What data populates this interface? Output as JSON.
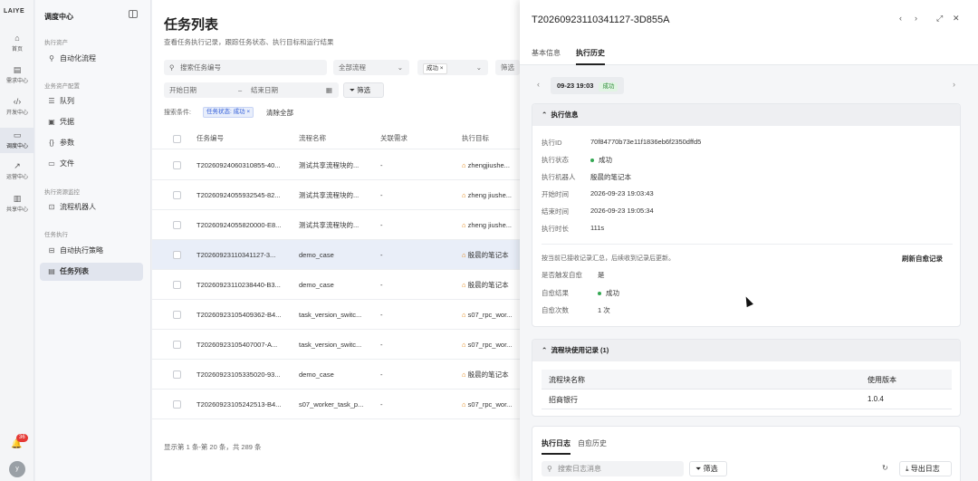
{
  "rail": {
    "logo": "LAIYE",
    "items": [
      {
        "label": "首页",
        "icon": "home-icon"
      },
      {
        "label": "需求中心",
        "icon": "document-icon"
      },
      {
        "label": "开发中心",
        "icon": "code-icon"
      },
      {
        "label": "调度中心",
        "icon": "monitor-icon"
      },
      {
        "label": "运营中心",
        "icon": "chart-icon"
      },
      {
        "label": "共享中心",
        "icon": "book-icon"
      }
    ],
    "notifications": "36",
    "avatar": "y"
  },
  "sidebar": {
    "title": "调度中心",
    "g1": "执行资产",
    "n1": "自动化流程",
    "g2": "业务资产配置",
    "n2": "队列",
    "n3": "凭据",
    "n4": "参数",
    "n5": "文件",
    "g3": "执行资源监控",
    "n6": "流程机器人",
    "g4": "任务执行",
    "n7": "自动执行策略",
    "n8": "任务列表"
  },
  "main": {
    "title": "任务列表",
    "subtitle": "查看任务执行记录，跟踪任务状态、执行目标和运行结果",
    "search_placeholder": "搜索任务编号",
    "flow_select": "全部流程",
    "status_tag": "成功",
    "filter_select": "筛选",
    "start_date": "开始日期",
    "date_sep": "–",
    "end_date": "结束日期",
    "filter_btn": "筛选",
    "cond_label": "搜索条件:",
    "cond_tag": "任务状态: 成功",
    "clear_all": "清除全部",
    "columns": [
      "任务编号",
      "流程名称",
      "关联需求",
      "执行目标"
    ],
    "rows": [
      [
        "T20260924060310855-40...",
        "测试共享流程块的...",
        "-",
        "zhengjiushe..."
      ],
      [
        "T20260924055932545-82...",
        "测试共享流程块的...",
        "-",
        "zheng jiushe..."
      ],
      [
        "T20260924055820000-E8...",
        "测试共享流程块的...",
        "-",
        "zheng jiushe..."
      ],
      [
        "T20260923110341127-3...",
        "demo_case",
        "-",
        "殷晨的笔记本"
      ],
      [
        "T20260923110238440-B3...",
        "demo_case",
        "-",
        "殷晨的笔记本"
      ],
      [
        "T20260923105409362-B4...",
        "task_version_switc...",
        "-",
        "s07_rpc_wor..."
      ],
      [
        "T20260923105407007-A...",
        "task_version_switc...",
        "-",
        "s07_rpc_wor..."
      ],
      [
        "T20260923105335020-93...",
        "demo_case",
        "-",
        "殷晨的笔记本"
      ],
      [
        "T20260923105242513-B4...",
        "s07_worker_task_p...",
        "-",
        "s07_rpc_wor..."
      ]
    ],
    "footer": "显示第 1 条-第 20 条，共 289 条"
  },
  "panel": {
    "title": "T20260923110341127-3D855A",
    "tab1": "基本信息",
    "tab2": "执行历史",
    "date_chip": "09-23 19:03",
    "date_status": "成功",
    "exec_title": "执行信息",
    "exec": [
      [
        "执行ID",
        "70f84770b73e11f1836eb6f2350dffd5"
      ],
      [
        "执行状态",
        "成功"
      ],
      [
        "执行机器人",
        "殷晨的笔记本"
      ],
      [
        "开始时间",
        "2026-09-23 19:03:43"
      ],
      [
        "结束时间",
        "2026-09-23 19:05:34"
      ],
      [
        "执行时长",
        "111s"
      ]
    ],
    "heal_note": "按当前已接收记录汇总，后续收到记录后更新。",
    "refresh": "刷新自愈记录",
    "heal": [
      [
        "是否触发自愈",
        "是"
      ],
      [
        "自愈结果",
        "成功"
      ],
      [
        "自愈次数",
        "1 次"
      ]
    ],
    "block_title": "流程块使用记录 (1)",
    "block_cols": [
      "流程块名称",
      "使用版本"
    ],
    "block_row": [
      "招商银行",
      "1.0.4"
    ],
    "log_tab1": "执行日志",
    "log_tab2": "自愈历史",
    "log_search": "搜索日志消息",
    "log_filter": "筛选",
    "export": "导出日志"
  }
}
